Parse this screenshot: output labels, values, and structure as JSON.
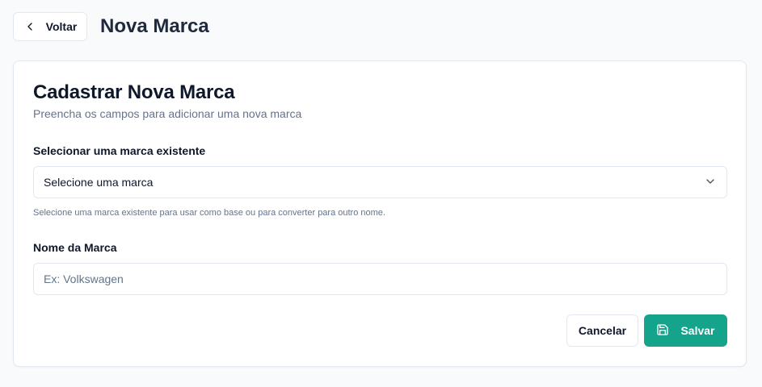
{
  "header": {
    "back_label": "Voltar",
    "title": "Nova Marca"
  },
  "card": {
    "title": "Cadastrar Nova Marca",
    "subtitle": "Preencha os campos para adicionar uma nova marca"
  },
  "existing_brand": {
    "label": "Selecionar uma marca existente",
    "selected_value": "Selecione uma marca",
    "help_text": "Selecione uma marca existente para usar como base ou para converter para outro nome."
  },
  "brand_name": {
    "label": "Nome da Marca",
    "value": "",
    "placeholder": "Ex: Volkswagen"
  },
  "actions": {
    "cancel_label": "Cancelar",
    "save_label": "Salvar"
  },
  "colors": {
    "accent": "#14a38b",
    "border": "#e2e8f0",
    "muted_text": "#64748b",
    "background": "#f8fafc"
  },
  "icons": {
    "back": "chevron-left-icon",
    "select": "chevron-down-icon",
    "save": "save-icon"
  }
}
